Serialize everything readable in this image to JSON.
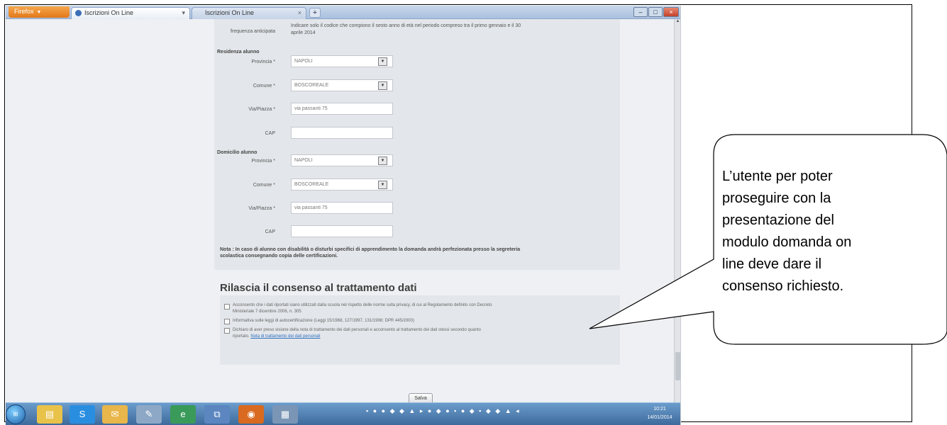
{
  "browser": {
    "button_label": "Firefox",
    "tabs": [
      {
        "label": "Iscrizioni On Line"
      },
      {
        "label": "Iscrizioni On Line"
      }
    ],
    "new_tab_label": "+",
    "min_label": "–",
    "max_label": "□",
    "close_label": "×"
  },
  "form": {
    "residence_note_label": "frequenza anticipata",
    "residence_note_text": "Indicare solo il codice che compiono il sesto anno di età nel periodo compreso tra il primo gennaio e il 30",
    "residence_note_text2": "aprile 2014",
    "residenza": {
      "section": "Residenza alunno",
      "provincia_label": "Provincia *",
      "provincia_value": "NAPOLI",
      "comune_label": "Comune *",
      "comune_value": "BOSCOREALE",
      "via_label": "Via/Piazza *",
      "via_value": "via passanti 75",
      "cap_label": "CAP",
      "cap_value": ""
    },
    "domicilio": {
      "section": "Domicilio alunno",
      "provincia_label": "Provincia *",
      "provincia_value": "NAPOLI",
      "comune_label": "Comune *",
      "comune_value": "BOSCOREALE",
      "via_label": "Via/Piazza *",
      "via_value": "via passanti 75",
      "cap_label": "CAP",
      "cap_value": ""
    },
    "note_line1": "Nota : In caso di alunno con disabilità o disturbi specifici di apprendimento la domanda andrà perfezionata presso la segreteria",
    "note_line2": "scolastica consegnando copia delle certificazioni."
  },
  "consent": {
    "title": "Rilascia il consenso al trattamento dati",
    "items": [
      {
        "text": "Acconsento che i dati riportati siano utilizzati dalla scuola nel rispetto delle norme sulla privacy, di cui al Regolamento definito con Decreto",
        "text2": "Ministeriale 7 dicembre 2006, n. 305"
      },
      {
        "text": "Informativa sulle leggi di autocertificazione (Leggi 15/1968, 127/1997, 131/1998; DPR 445/2000)",
        "text2": ""
      },
      {
        "text": "Dichiaro di aver preso visione della nota di trattamento dei dati personali e acconsento al trattamento dei dati stessi secondo quanto",
        "text2": "riportato.",
        "link": "Nota di trattamento dei dati personali"
      }
    ]
  },
  "save_label": "Salva",
  "taskbar": {
    "clock_time": "10:21",
    "clock_date": "14/01/2014"
  },
  "callout": {
    "lines": [
      "L’utente per poter",
      "proseguire con la",
      "presentazione del",
      "modulo domanda on",
      "line deve dare il",
      "consenso richiesto."
    ]
  }
}
